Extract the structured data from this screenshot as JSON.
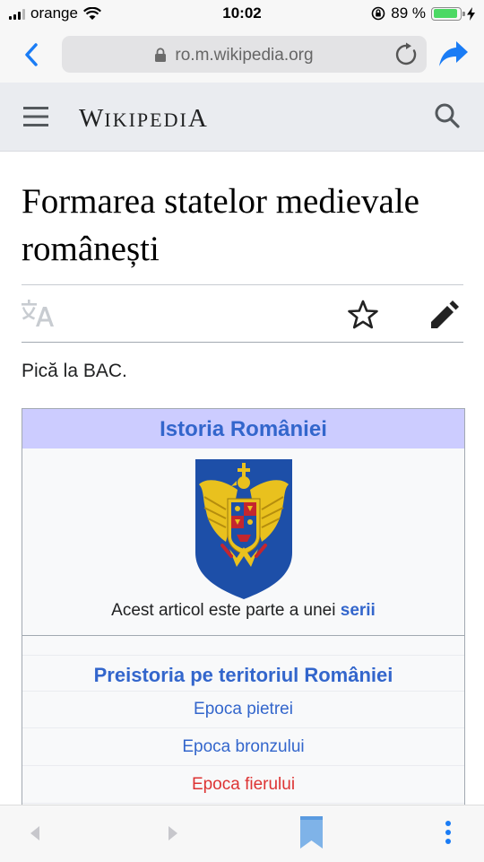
{
  "status": {
    "carrier": "orange",
    "time": "10:02",
    "battery": "89 %",
    "battery_level": 0.89
  },
  "browser": {
    "url": "ro.m.wikipedia.org"
  },
  "wiki": {
    "wordmark_first": "W",
    "wordmark_small": "IKIPEDI",
    "wordmark_last": "A",
    "title": "Formarea statelor medievale românești",
    "intro": "Pică la BAC."
  },
  "infobox": {
    "title": "Istoria României",
    "caption_text": "Acest articol este parte a unei ",
    "caption_link": "serii",
    "section": "Preistoria pe teritoriul României",
    "items": [
      "Epoca pietrei",
      "Epoca bronzului",
      "Epoca fierului"
    ]
  },
  "colors": {
    "link": "#3366cc",
    "redlink": "#d33",
    "infobox_header": "#ccccff",
    "ios_blue": "#1a7cf5"
  },
  "icons": [
    "signal-icon",
    "wifi-icon",
    "lock-rotation-icon",
    "battery-icon",
    "charging-icon",
    "back-icon",
    "lock-icon",
    "reload-icon",
    "share-icon",
    "menu-icon",
    "search-icon",
    "language-icon",
    "star-icon",
    "edit-icon",
    "coat-of-arms-icon",
    "nav-back-icon",
    "nav-forward-icon",
    "bookmarks-icon",
    "more-icon"
  ]
}
